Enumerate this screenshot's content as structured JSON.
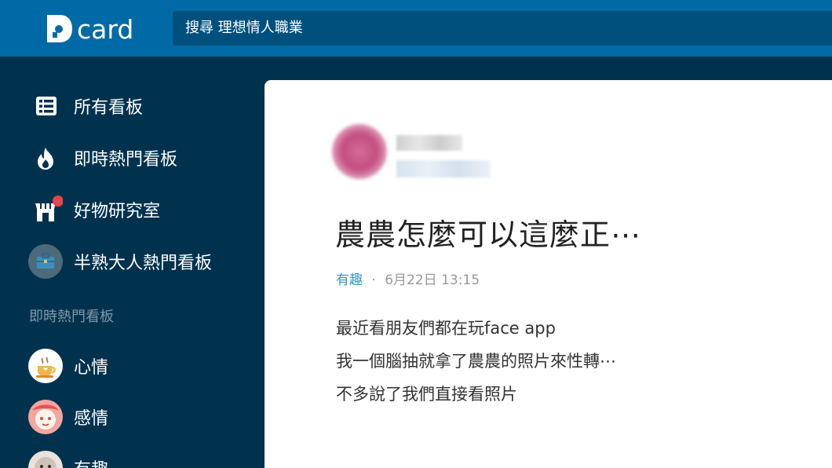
{
  "brand": {
    "logo_text": "card"
  },
  "search": {
    "text": "搜尋 理想情人職業"
  },
  "sidebar": {
    "items": [
      {
        "label": "所有看板",
        "icon": "list-icon"
      },
      {
        "label": "即時熱門看板",
        "icon": "flame-icon"
      },
      {
        "label": "好物研究室",
        "icon": "shop-icon",
        "has_badge": true
      },
      {
        "label": "半熟大人熱門看板",
        "icon": "briefcase-icon"
      }
    ],
    "section_title": "即時熱門看板",
    "boards": [
      {
        "label": "心情",
        "icon": "coffee-cup-icon"
      },
      {
        "label": "感情",
        "icon": "love-icon"
      },
      {
        "label": "有趣",
        "icon": "dog-icon"
      }
    ]
  },
  "post": {
    "title": "農農怎麼可以這麼正⋯",
    "board": "有趣",
    "separator": "·",
    "datetime": "6月22日 13:15",
    "body": [
      "最近看朋友們都在玩face app",
      "我一個腦抽就拿了農農的照片來性轉⋯",
      "不多說了我們直接看照片"
    ]
  },
  "colors": {
    "topbar": "#006aa6",
    "sidebar": "#00324e",
    "accent": "#3397cf",
    "badge": "#e8454c"
  }
}
